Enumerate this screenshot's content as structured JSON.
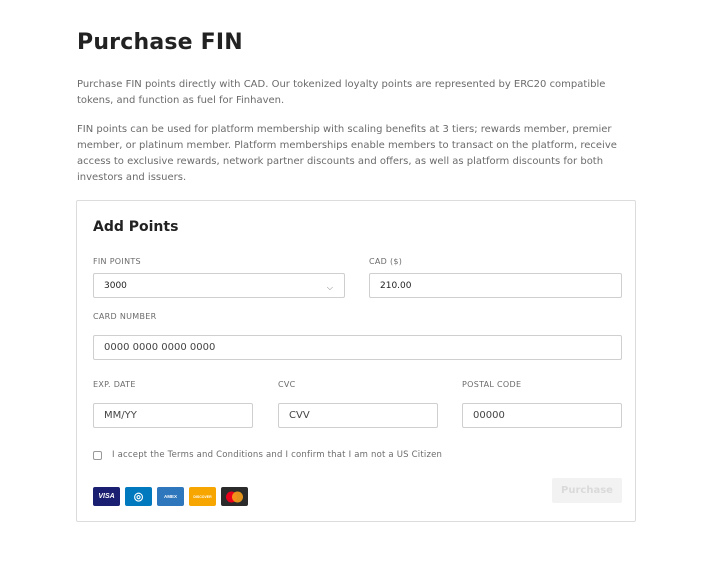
{
  "page": {
    "title": "Purchase FIN",
    "intro": "Purchase FIN points directly with CAD. Our tokenized loyalty points are represented by ERC20 compatible tokens, and function as fuel for Finhaven.",
    "details": "FIN points can be used for platform membership with scaling benefits at 3 tiers; rewards member, premier member, or platinum member. Platform memberships enable members to transact on the platform, receive access to exclusive rewards, network partner discounts and offers, as well as platform discounts for both investors and issuers."
  },
  "form": {
    "title": "Add Points",
    "fin_points": {
      "label": "FIN POINTS",
      "value": "3000"
    },
    "cad": {
      "label": "CAD ($)",
      "value": "210.00"
    },
    "card_number": {
      "label": "CARD NUMBER",
      "placeholder": "0000 0000 0000 0000"
    },
    "exp_date": {
      "label": "EXP. DATE",
      "placeholder": "MM/YY"
    },
    "cvc": {
      "label": "CVC",
      "placeholder": "CVV"
    },
    "postal_code": {
      "label": "POSTAL CODE",
      "placeholder": "00000"
    },
    "terms": "I accept the Terms and Conditions and I confirm that I am not a US Citizen",
    "purchase_label": "Purchase",
    "card_logos": [
      {
        "name": "visa-logo",
        "text": "VISA",
        "color": "#1a1f71"
      },
      {
        "name": "diners-logo",
        "text": "◎",
        "color": "#0079be"
      },
      {
        "name": "amex-logo",
        "text": "AMEX",
        "color": "#2e77bc"
      },
      {
        "name": "discover-logo",
        "text": "DISCOVER",
        "color": "#f7a600"
      },
      {
        "name": "mastercard-logo",
        "text": "",
        "color": "#2b2b2b"
      }
    ]
  },
  "colors": {
    "text": "#222222",
    "muted": "#6b6b6b",
    "border": "#dcdcdc",
    "button_disabled_bg": "#f2f2f2"
  }
}
